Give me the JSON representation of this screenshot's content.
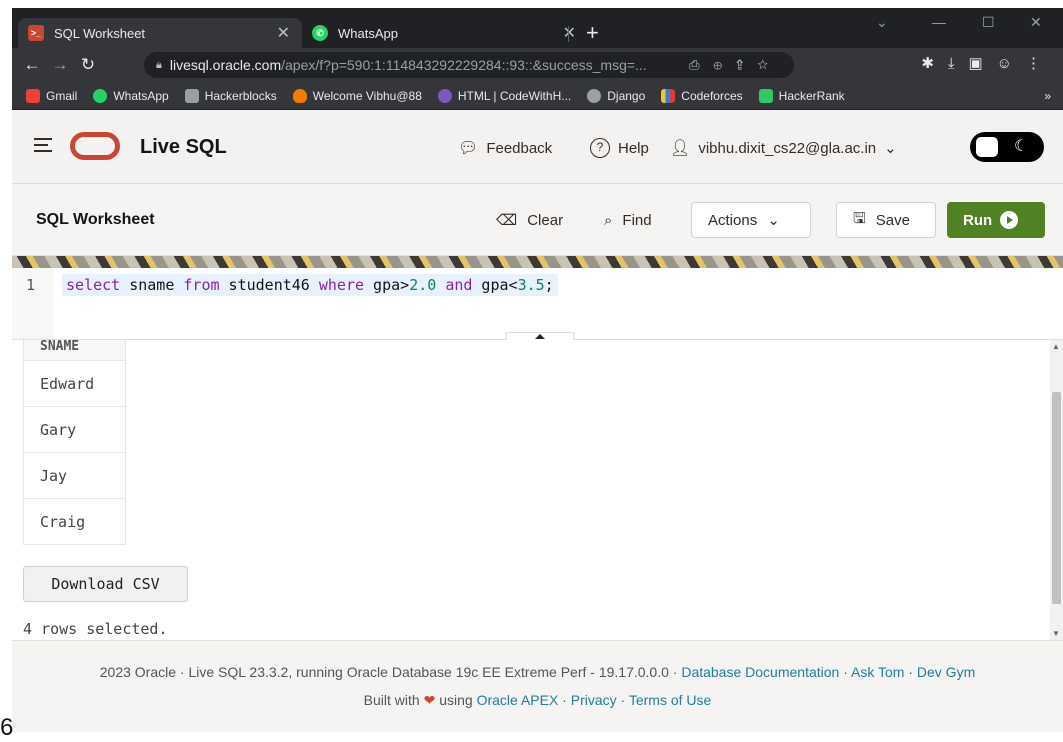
{
  "browser": {
    "tabs": [
      {
        "title": "SQL Worksheet",
        "active": true,
        "icon": "oracle-sql-icon"
      },
      {
        "title": "WhatsApp",
        "active": false,
        "icon": "whatsapp-icon"
      }
    ],
    "url_host": "livesql.oracle.com",
    "url_path": "/apex/f?p=590:1:114843292229284::93::&success_msg=...",
    "bookmarks": [
      {
        "label": "Gmail",
        "color": "#ea4335"
      },
      {
        "label": "WhatsApp",
        "color": "#25d366"
      },
      {
        "label": "Hackerblocks",
        "color": "#9aa0a6"
      },
      {
        "label": "Welcome Vibhu@88",
        "color": "#f57c00"
      },
      {
        "label": "HTML | CodeWithH...",
        "color": "#7e57c2"
      },
      {
        "label": "Django",
        "color": "#9aa0a6"
      },
      {
        "label": "Codeforces",
        "color": "#1e88e5"
      },
      {
        "label": "HackerRank",
        "color": "#2ec866"
      }
    ],
    "bookmarks_more": "»"
  },
  "header": {
    "app_title": "Live SQL",
    "feedback": "Feedback",
    "help": "Help",
    "user": "vibhu.dixit_cs22@gla.ac.in"
  },
  "worksheet": {
    "title": "SQL Worksheet",
    "clear": "Clear",
    "find": "Find",
    "actions": "Actions",
    "save": "Save",
    "run": "Run"
  },
  "editor": {
    "line_number": "1",
    "tokens": [
      {
        "text": "select",
        "kind": "kw"
      },
      {
        "text": " sname ",
        "kind": "plain"
      },
      {
        "text": "from",
        "kind": "kw"
      },
      {
        "text": " student46 ",
        "kind": "plain"
      },
      {
        "text": "where",
        "kind": "kw"
      },
      {
        "text": " gpa>",
        "kind": "plain"
      },
      {
        "text": "2.0",
        "kind": "num"
      },
      {
        "text": " ",
        "kind": "plain"
      },
      {
        "text": "and",
        "kind": "kw"
      },
      {
        "text": " gpa<",
        "kind": "plain"
      },
      {
        "text": "3.5",
        "kind": "num"
      },
      {
        "text": ";",
        "kind": "plain"
      }
    ]
  },
  "results": {
    "column": "SNAME",
    "rows": [
      "Edward",
      "Gary",
      "Jay",
      "Craig"
    ],
    "download": "Download CSV",
    "status": "4 rows selected."
  },
  "footer": {
    "text1": "2023 Oracle · Live SQL 23.3.2, running Oracle Database 19c EE Extreme Perf - 19.17.0.0.0 · ",
    "link_docs": "Database Documentation",
    "sep1": " · ",
    "link_asktom": "Ask Tom",
    "sep2": " · ",
    "link_devgym": "Dev Gym",
    "built_with": "Built with",
    "using": "using",
    "link_apex": "Oracle APEX",
    "sep3": " · ",
    "link_privacy": "Privacy",
    "sep4": " · ",
    "link_terms": "Terms of Use"
  },
  "stray_char": "6"
}
